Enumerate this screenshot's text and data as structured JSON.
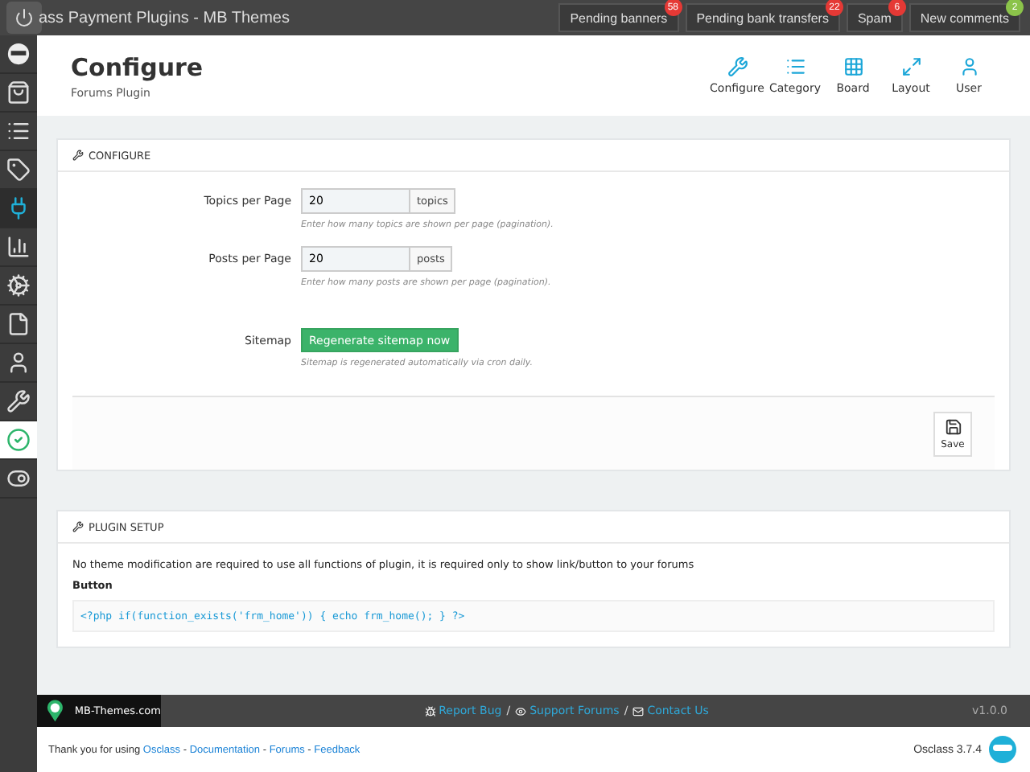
{
  "top_bar": {
    "title": "ass Payment Plugins - MB Themes",
    "notices": [
      {
        "label": "Pending banners",
        "count": "58",
        "color": "#e53935"
      },
      {
        "label": "Pending bank transfers",
        "count": "22",
        "color": "#e53935"
      },
      {
        "label": "Spam",
        "count": "6",
        "color": "#e53935"
      },
      {
        "label": "New comments",
        "count": "2",
        "color": "#8bc34a"
      }
    ]
  },
  "sidebar": {
    "items": [
      {
        "selected": false
      },
      {
        "selected": false
      },
      {
        "selected": false
      },
      {
        "selected": false
      },
      {
        "selected": true
      },
      {
        "selected": false
      },
      {
        "selected": false
      },
      {
        "selected": false
      },
      {
        "selected": false
      },
      {
        "selected": false
      },
      {
        "selected": false
      },
      {
        "selected": false
      }
    ]
  },
  "header": {
    "title": "Configure",
    "subtitle": "Forums Plugin",
    "nav": [
      {
        "label": "Configure"
      },
      {
        "label": "Category"
      },
      {
        "label": "Board"
      },
      {
        "label": "Layout"
      },
      {
        "label": "User"
      }
    ]
  },
  "configure": {
    "heading": "CONFIGURE",
    "fields": [
      {
        "kind": "input",
        "label": "Topics per Page",
        "value": "20",
        "addon": "topics",
        "help": "Enter how many topics are shown per page (pagination)."
      },
      {
        "kind": "input",
        "label": "Posts per Page",
        "value": "20",
        "addon": "posts",
        "help": "Enter how many posts are shown per page (pagination)."
      },
      {
        "kind": "button",
        "label": "Sitemap",
        "button": "Regenerate sitemap now",
        "help": "Sitemap is regenerated automatically via cron daily."
      }
    ],
    "save": "Save"
  },
  "setup": {
    "heading": "PLUGIN SETUP",
    "text": "No theme modification are required to use all functions of plugin, it is required only to show link/button to your forums",
    "label": "Button",
    "code": "<?php if(function_exists('frm_home')) { echo frm_home(); } ?>"
  },
  "footer": {
    "brand": "MB-Themes.com",
    "separator": "/",
    "links": [
      "Report Bug",
      "Support Forums",
      "Contact Us"
    ],
    "version": "v1.0.0"
  },
  "bottom": {
    "prefix": "Thank you for using",
    "separator": "-",
    "links": [
      "Osclass",
      "Documentation",
      "Forums",
      "Feedback"
    ],
    "version": "Osclass 3.7.4"
  }
}
